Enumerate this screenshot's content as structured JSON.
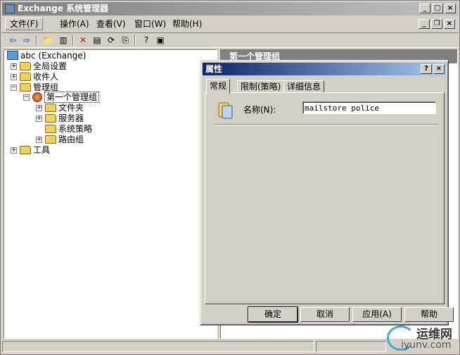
{
  "window": {
    "title": "Exchange 系统管理器"
  },
  "menubar": {
    "items": [
      "文件(F)",
      "操作(A)",
      "查看(V)",
      "窗口(W)",
      "帮助(H)"
    ]
  },
  "tree": {
    "root": "abc (Exchange)",
    "items": [
      "全局设置",
      "收件人",
      "管理组",
      "第一个管理组",
      "文件夹",
      "服务器",
      "系统策略",
      "路由组",
      "工具"
    ]
  },
  "right_pane": {
    "header": "第一个管理组"
  },
  "dialog": {
    "title": "属性",
    "tabs": [
      "常规",
      "限制(策略)",
      "详细信息"
    ],
    "name_label": "名称(N):",
    "name_value": "mailstore police",
    "buttons": {
      "ok": "确定",
      "cancel": "取消",
      "apply": "应用(A)",
      "help": "帮助"
    }
  },
  "watermark": {
    "brand": "运维网",
    "url": "iyunv.com"
  },
  "colors": {
    "dialog_title": "#0a246a",
    "tree_bg": "#ffffff",
    "chrome": "#d4d0c8"
  }
}
